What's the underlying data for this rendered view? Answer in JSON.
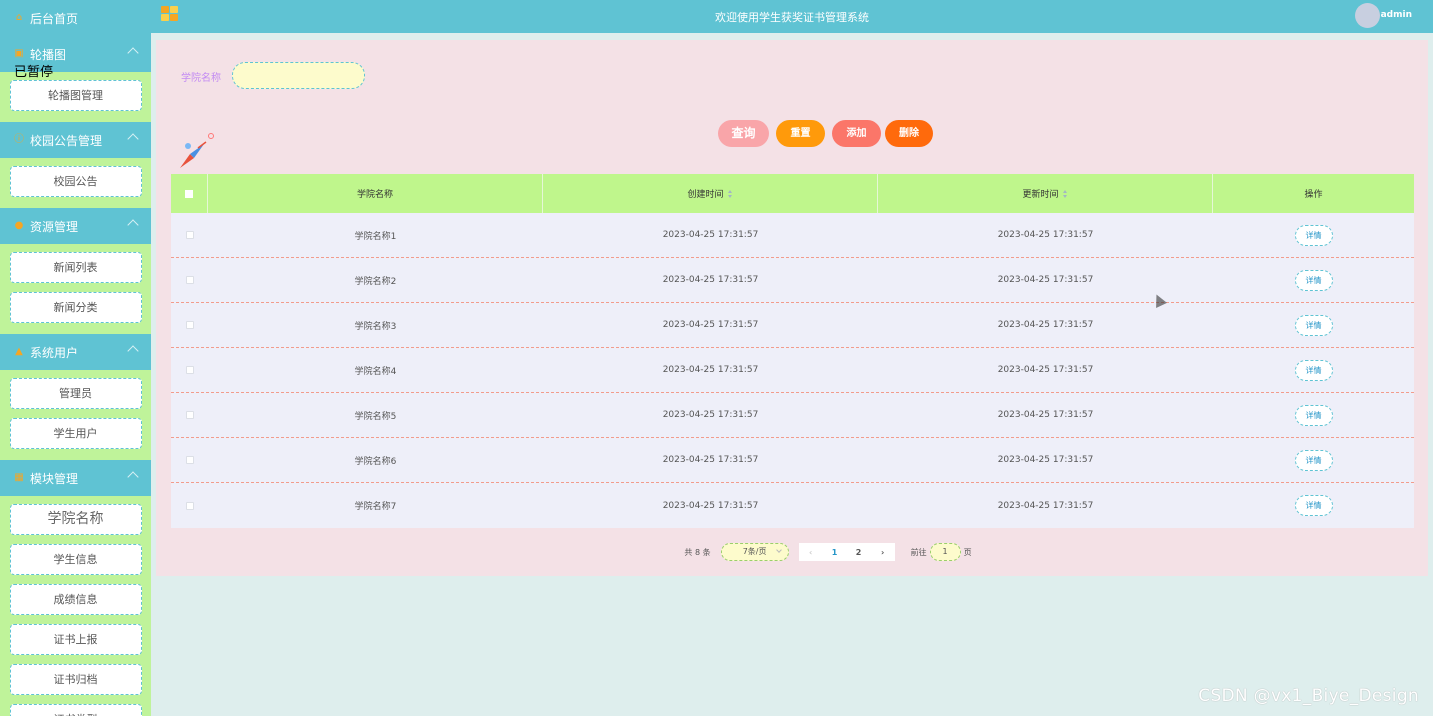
{
  "header": {
    "title": "欢迎使用学生获奖证书管理系统",
    "username": "admin"
  },
  "sidebar": {
    "home": "后台首页",
    "overlay": "已暂停",
    "groups": [
      {
        "title": "轮播图",
        "icon": "image-icon",
        "items": [
          "轮播图管理"
        ]
      },
      {
        "title": "校园公告管理",
        "icon": "info-icon",
        "items": [
          "校园公告"
        ]
      },
      {
        "title": "资源管理",
        "icon": "location-icon",
        "items": [
          "新闻列表",
          "新闻分类"
        ]
      },
      {
        "title": "系统用户",
        "icon": "user-icon",
        "items": [
          "管理员",
          "学生用户"
        ]
      },
      {
        "title": "模块管理",
        "icon": "grid-icon",
        "items": [
          "学院名称",
          "学生信息",
          "成绩信息",
          "证书上报",
          "证书归档",
          "证书类型"
        ]
      }
    ]
  },
  "search": {
    "label": "学院名称",
    "value": ""
  },
  "buttons": {
    "query": "查询",
    "reset": "重置",
    "add": "添加",
    "delete": "删除"
  },
  "table": {
    "columns": [
      "学院名称",
      "创建时间",
      "更新时间",
      "操作"
    ],
    "detail_label": "详情",
    "rows": [
      {
        "name": "学院名称1",
        "created": "2023-04-25 17:31:57",
        "updated": "2023-04-25 17:31:57"
      },
      {
        "name": "学院名称2",
        "created": "2023-04-25 17:31:57",
        "updated": "2023-04-25 17:31:57"
      },
      {
        "name": "学院名称3",
        "created": "2023-04-25 17:31:57",
        "updated": "2023-04-25 17:31:57"
      },
      {
        "name": "学院名称4",
        "created": "2023-04-25 17:31:57",
        "updated": "2023-04-25 17:31:57"
      },
      {
        "name": "学院名称5",
        "created": "2023-04-25 17:31:57",
        "updated": "2023-04-25 17:31:57"
      },
      {
        "name": "学院名称6",
        "created": "2023-04-25 17:31:57",
        "updated": "2023-04-25 17:31:57"
      },
      {
        "name": "学院名称7",
        "created": "2023-04-25 17:31:57",
        "updated": "2023-04-25 17:31:57"
      }
    ]
  },
  "pagination": {
    "total": "共 8 条",
    "page_size": "7条/页",
    "pages": [
      "1",
      "2"
    ],
    "current": "1",
    "goto_prefix": "前往",
    "goto_value": "1",
    "goto_suffix": "页"
  },
  "watermark": "CSDN @vx1_Biye_Design"
}
